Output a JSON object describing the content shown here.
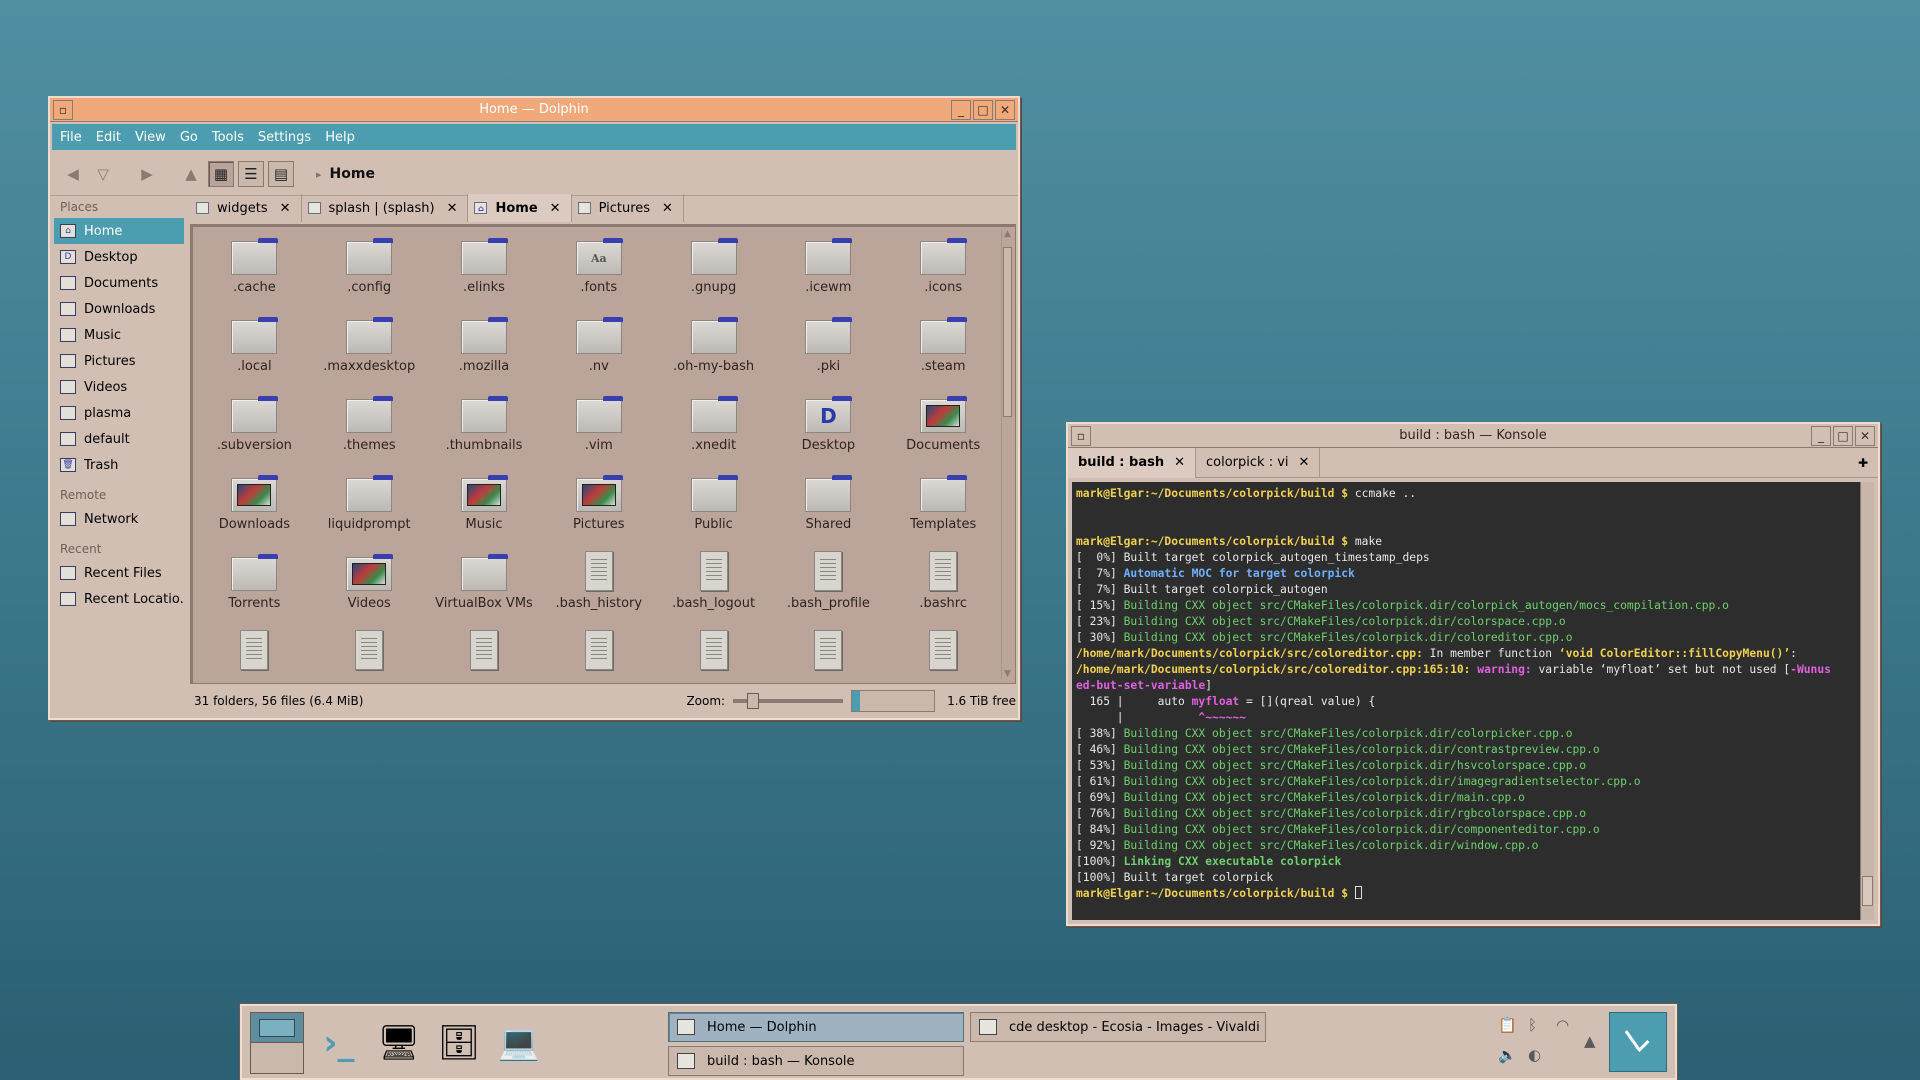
{
  "dolphin": {
    "title": "Home — Dolphin",
    "menu": [
      "File",
      "Edit",
      "View",
      "Go",
      "Tools",
      "Settings",
      "Help"
    ],
    "breadcrumb": "Home",
    "places": {
      "places_header": "Places",
      "places_items": [
        "Home",
        "Desktop",
        "Documents",
        "Downloads",
        "Music",
        "Pictures",
        "Videos",
        "plasma",
        "default",
        "Trash"
      ],
      "remote_header": "Remote",
      "remote_items": [
        "Network"
      ],
      "recent_header": "Recent",
      "recent_items": [
        "Recent Files",
        "Recent Locatio..."
      ]
    },
    "tabs": [
      {
        "label": "widgets",
        "active": false
      },
      {
        "label": "splash | (splash)",
        "active": false
      },
      {
        "label": "Home",
        "active": true
      },
      {
        "label": "Pictures",
        "active": false
      }
    ],
    "files": [
      {
        "name": ".cache",
        "type": "folder"
      },
      {
        "name": ".config",
        "type": "folder"
      },
      {
        "name": ".elinks",
        "type": "folder"
      },
      {
        "name": ".fonts",
        "type": "fonts"
      },
      {
        "name": ".gnupg",
        "type": "folder"
      },
      {
        "name": ".icewm",
        "type": "folder"
      },
      {
        "name": ".icons",
        "type": "folder"
      },
      {
        "name": ".local",
        "type": "folder"
      },
      {
        "name": ".maxxdesktop",
        "type": "folder"
      },
      {
        "name": ".mozilla",
        "type": "folder"
      },
      {
        "name": ".nv",
        "type": "folder"
      },
      {
        "name": ".oh-my-bash",
        "type": "folder"
      },
      {
        "name": ".pki",
        "type": "folder"
      },
      {
        "name": ".steam",
        "type": "folder"
      },
      {
        "name": ".subversion",
        "type": "folder"
      },
      {
        "name": ".themes",
        "type": "folder"
      },
      {
        "name": ".thumbnails",
        "type": "folder"
      },
      {
        "name": ".vim",
        "type": "folder"
      },
      {
        "name": ".xnedit",
        "type": "folder"
      },
      {
        "name": "Desktop",
        "type": "desktop"
      },
      {
        "name": "Documents",
        "type": "thumb"
      },
      {
        "name": "Downloads",
        "type": "thumb"
      },
      {
        "name": "liquidprompt",
        "type": "folder"
      },
      {
        "name": "Music",
        "type": "thumb"
      },
      {
        "name": "Pictures",
        "type": "thumb"
      },
      {
        "name": "Public",
        "type": "folder"
      },
      {
        "name": "Shared",
        "type": "folder"
      },
      {
        "name": "Templates",
        "type": "folder"
      },
      {
        "name": "Torrents",
        "type": "folder"
      },
      {
        "name": "Videos",
        "type": "thumb"
      },
      {
        "name": "VirtualBox VMs",
        "type": "folder"
      },
      {
        "name": ".bash_history",
        "type": "file"
      },
      {
        "name": ".bash_logout",
        "type": "file"
      },
      {
        "name": ".bash_profile",
        "type": "file"
      },
      {
        "name": ".bashrc",
        "type": "file"
      },
      {
        "name": "",
        "type": "file"
      },
      {
        "name": "",
        "type": "file"
      },
      {
        "name": "",
        "type": "file"
      },
      {
        "name": "",
        "type": "file"
      },
      {
        "name": "",
        "type": "file"
      },
      {
        "name": "",
        "type": "file"
      },
      {
        "name": "",
        "type": "file"
      }
    ],
    "status": "31 folders, 56 files (6.4 MiB)",
    "zoom_label": "Zoom:",
    "free_space": "1.6 TiB free"
  },
  "konsole": {
    "title": "build : bash — Konsole",
    "tabs": [
      {
        "label": "build : bash",
        "active": true
      },
      {
        "label": "colorpick : vi",
        "active": false
      }
    ],
    "prompt": "mark@Elgar:~/Documents/colorpick/build $",
    "cmd1": " ccmake ..",
    "cmd2": " make",
    "lines": [
      {
        "pre": "[  0%] ",
        "text": "Built target colorpick_autogen_timestamp_deps",
        "cls": ""
      },
      {
        "pre": "[  7%] ",
        "text": "Automatic MOC for target colorpick",
        "cls": "c-blue"
      },
      {
        "pre": "[  7%] ",
        "text": "Built target colorpick_autogen",
        "cls": ""
      },
      {
        "pre": "[ 15%] ",
        "text": "Building CXX object src/CMakeFiles/colorpick.dir/colorpick_autogen/mocs_compilation.cpp.o",
        "cls": "c-green"
      },
      {
        "pre": "[ 23%] ",
        "text": "Building CXX object src/CMakeFiles/colorpick.dir/colorspace.cpp.o",
        "cls": "c-green"
      },
      {
        "pre": "[ 30%] ",
        "text": "Building CXX object src/CMakeFiles/colorpick.dir/coloreditor.cpp.o",
        "cls": "c-green"
      }
    ],
    "err_path1": "/home/mark/Documents/colorpick/src/coloreditor.cpp:",
    "err_text1": " In member function ",
    "err_fn": "‘void ColorEditor::fillCopyMenu()’",
    "err_tail1": ":",
    "err_path2": "/home/mark/Documents/colorpick/src/coloreditor.cpp:165:10:",
    "warn_label": " warning:",
    "warn_text": " variable ‘myfloat’ set but not used [",
    "warn_flag1": "-Wunus",
    "warn_flag2": "ed-but-set-variable",
    "warn_close": "]",
    "code_num": "  165 |",
    "code_pre": "     auto ",
    "code_var": "myfloat",
    "code_post": " = [](qreal value) {",
    "code_marker_bar": "      |",
    "code_marker": "           ^~~~~~~",
    "lines2": [
      {
        "pre": "[ 38%] ",
        "text": "Building CXX object src/CMakeFiles/colorpick.dir/colorpicker.cpp.o",
        "cls": "c-green"
      },
      {
        "pre": "[ 46%] ",
        "text": "Building CXX object src/CMakeFiles/colorpick.dir/contrastpreview.cpp.o",
        "cls": "c-green"
      },
      {
        "pre": "[ 53%] ",
        "text": "Building CXX object src/CMakeFiles/colorpick.dir/hsvcolorspace.cpp.o",
        "cls": "c-green"
      },
      {
        "pre": "[ 61%] ",
        "text": "Building CXX object src/CMakeFiles/colorpick.dir/imagegradientselector.cpp.o",
        "cls": "c-green"
      },
      {
        "pre": "[ 69%] ",
        "text": "Building CXX object src/CMakeFiles/colorpick.dir/main.cpp.o",
        "cls": "c-green"
      },
      {
        "pre": "[ 76%] ",
        "text": "Building CXX object src/CMakeFiles/colorpick.dir/rgbcolorspace.cpp.o",
        "cls": "c-green"
      },
      {
        "pre": "[ 84%] ",
        "text": "Building CXX object src/CMakeFiles/colorpick.dir/componenteditor.cpp.o",
        "cls": "c-green"
      },
      {
        "pre": "[ 92%] ",
        "text": "Building CXX object src/CMakeFiles/colorpick.dir/window.cpp.o",
        "cls": "c-green"
      },
      {
        "pre": "[100%] ",
        "text": "Linking CXX executable colorpick",
        "cls": "c-greenb"
      },
      {
        "pre": "[100%] ",
        "text": "Built target colorpick",
        "cls": ""
      }
    ]
  },
  "panel": {
    "tasks": [
      {
        "label": "Home — Dolphin",
        "active": true
      },
      {
        "label": "cde desktop - Ecosia - Images - Vivaldi",
        "active": false
      },
      {
        "label": "build : bash — Konsole",
        "active": false
      }
    ]
  },
  "colors": {
    "accent": "#4d9db0",
    "dolphin_titlebar": "#efa97a",
    "window_bg": "#d2bfb4",
    "terminal_bg": "#2d2d2d"
  }
}
